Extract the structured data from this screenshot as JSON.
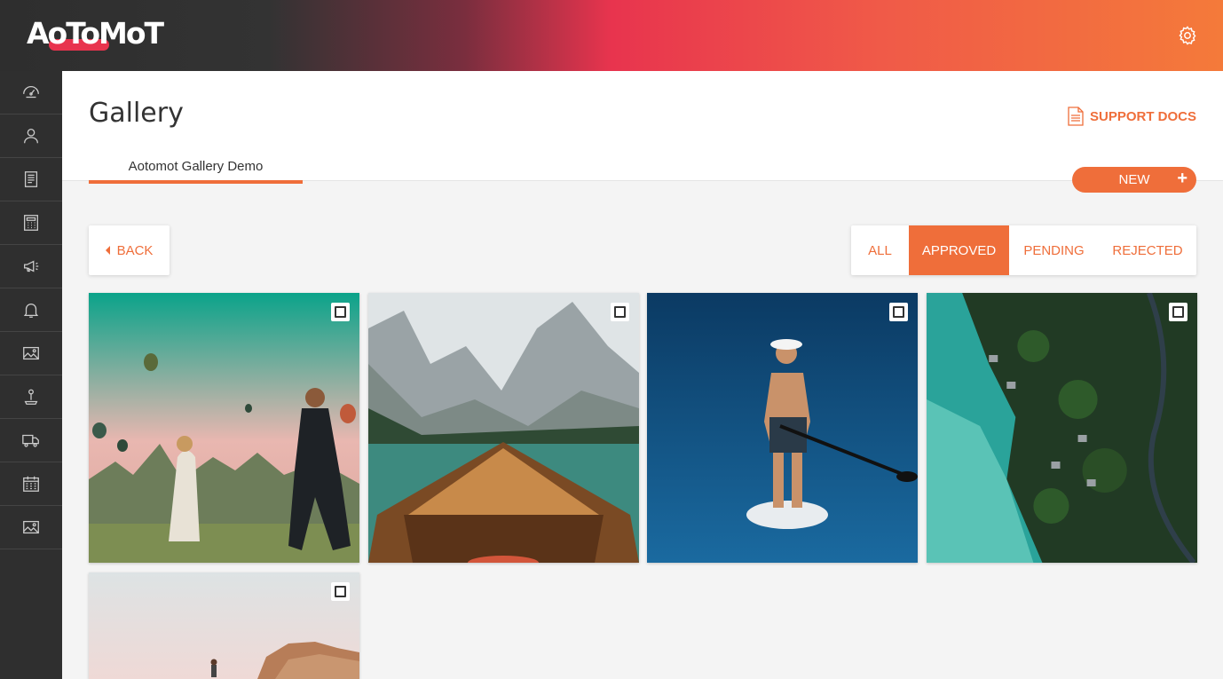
{
  "app": {
    "logo_text": "AoToMoT"
  },
  "header": {
    "title": "Gallery",
    "support_docs": "SUPPORT DOCS",
    "tab_label": "Aotomot Gallery Demo",
    "new_button": "NEW",
    "new_plus": "+"
  },
  "sidebar": {
    "items": [
      {
        "icon": "dashboard-icon"
      },
      {
        "icon": "user-icon"
      },
      {
        "icon": "document-icon"
      },
      {
        "icon": "calculator-icon"
      },
      {
        "icon": "megaphone-icon"
      },
      {
        "icon": "bell-icon"
      },
      {
        "icon": "image-icon"
      },
      {
        "icon": "joystick-icon"
      },
      {
        "icon": "truck-icon"
      },
      {
        "icon": "calendar-icon"
      },
      {
        "icon": "gallery-icon"
      }
    ]
  },
  "toolbar": {
    "back_label": "BACK",
    "filters": [
      {
        "label": "ALL",
        "active": false
      },
      {
        "label": "APPROVED",
        "active": true
      },
      {
        "label": "PENDING",
        "active": false
      },
      {
        "label": "REJECTED",
        "active": false
      }
    ]
  },
  "gallery": {
    "items": [
      {
        "subject": "hot-air-balloons-photographer",
        "checked": false
      },
      {
        "subject": "boat-mountain-lake",
        "checked": false
      },
      {
        "subject": "paddleboarder-ocean",
        "checked": false
      },
      {
        "subject": "aerial-coastline-forest",
        "checked": false
      },
      {
        "subject": "person-on-rocks-sky",
        "checked": false
      }
    ]
  },
  "colors": {
    "accent": "#ef6e3a",
    "sidebar_bg": "#2f2f2f",
    "gradient_pink": "#e8344e"
  }
}
